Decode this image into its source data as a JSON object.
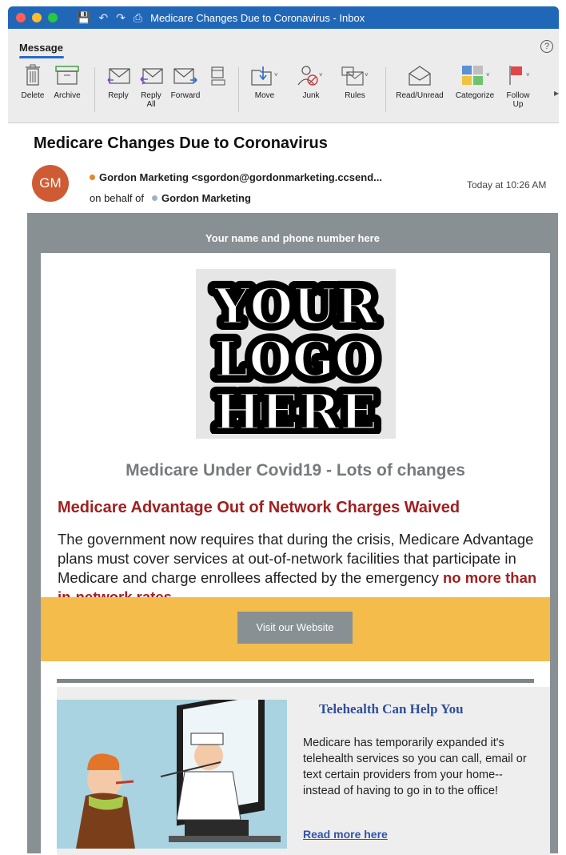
{
  "window": {
    "title": "Medicare Changes Due to Coronavirus - Inbox",
    "traffic_lights": [
      "#ff5f57",
      "#febc2e",
      "#28c840"
    ]
  },
  "ribbon": {
    "tab": "Message",
    "help": "?",
    "tools": {
      "delete": "Delete",
      "archive": "Archive",
      "reply": "Reply",
      "reply_all": "Reply All",
      "forward": "Forward",
      "move": "Move",
      "junk": "Junk",
      "rules": "Rules",
      "read_unread": "Read/Unread",
      "categorize": "Categorize",
      "follow_up": "Follow Up"
    }
  },
  "message": {
    "subject": "Medicare Changes Due to Coronavirus",
    "avatar_initials": "GM",
    "sender": "Gordon Marketing <sgordon@gordonmarketing.ccsend...",
    "on_behalf_of_label": "on behalf of",
    "on_behalf_of_name": "Gordon Marketing",
    "time": "Today at 10:26 AM"
  },
  "email": {
    "top_line": "Your name and phone number here",
    "logo_lines": [
      "YOUR",
      "LOGO",
      "HERE"
    ],
    "heading": "Medicare Under Covid19 - Lots of changes",
    "subheading": "Medicare Advantage Out of Network Charges Waived",
    "body": "The government now requires that during the crisis, Medicare Advantage plans must cover services at out-of-network facilities that participate in Medicare and charge enrollees affected by the emergency ",
    "body_emphasis": "no more than in-network rates.",
    "button": "Visit our Website",
    "tele_heading": "Telehealth Can Help You",
    "tele_body": "Medicare has temporarily expanded it's telehealth services so you can call, email or text certain providers from your home-- instead of having to go in to the office!",
    "read_more": "Read more here"
  },
  "colors": {
    "titlebar": "#2167b8",
    "email_frame": "#889094",
    "accent_red": "#a11f1f",
    "band_yellow": "#f3bc4b",
    "link_blue": "#2f54a8"
  }
}
